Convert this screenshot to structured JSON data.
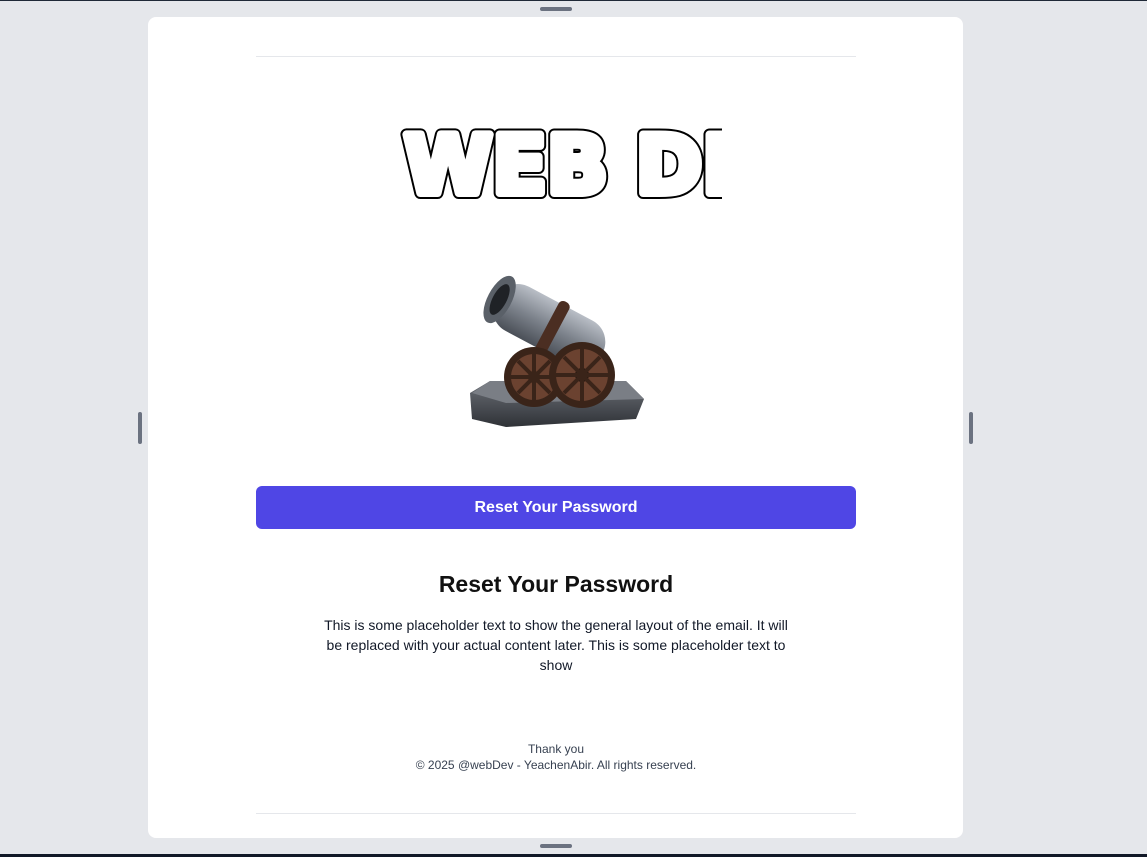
{
  "logo": {
    "text": "WEB DEV"
  },
  "cta": {
    "label": "Reset Your Password",
    "color": "#4f46e5"
  },
  "content": {
    "heading": "Reset Your Password",
    "body": "This is some placeholder text to show the general layout of the email. It will be replaced with your actual content later. This is some placeholder text to show"
  },
  "footer": {
    "thanks": "Thank you",
    "copyright": "© 2025 @webDev - YeachenAbir. All rights reserved."
  },
  "icons": {
    "hero": "cannon-icon"
  }
}
